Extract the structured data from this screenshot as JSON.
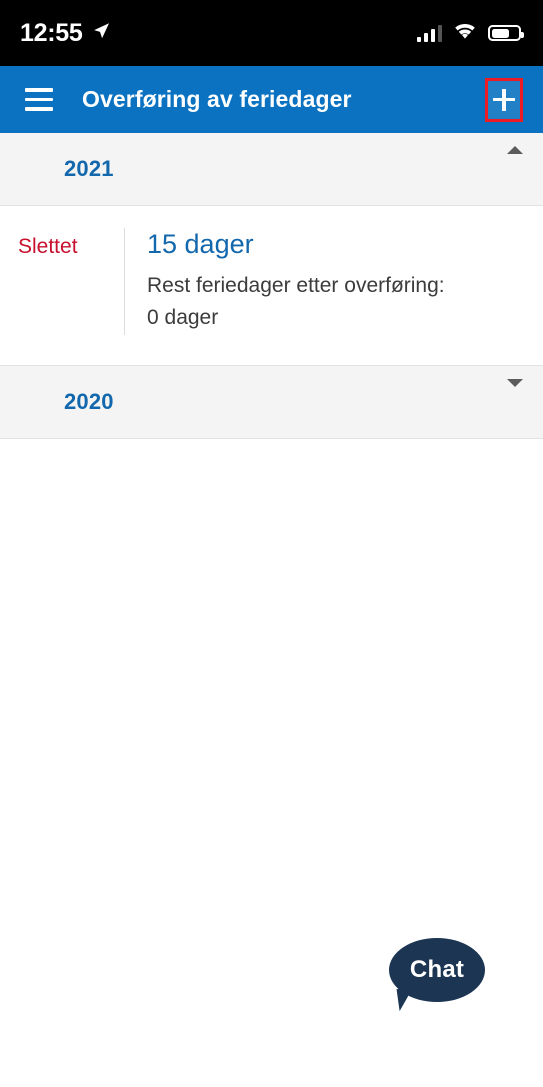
{
  "status_bar": {
    "time": "12:55",
    "location_icon": "location-arrow-icon",
    "signal_icon": "cellular-signal-icon",
    "signal_bars_filled": 3,
    "signal_bars_total": 4,
    "wifi_icon": "wifi-icon",
    "battery_icon": "battery-icon",
    "battery_level_percent": 60
  },
  "app_bar": {
    "menu_icon": "hamburger-menu-icon",
    "title": "Overføring av feriedager",
    "add_icon": "plus-icon",
    "add_label": "+",
    "highlight_color": "#ee1b25",
    "background_color": "#0a72c0"
  },
  "sections": [
    {
      "year": "2021",
      "expanded": true,
      "caret_icon": "chevron-up-icon",
      "rows": [
        {
          "status": "Slettet",
          "status_color": "#c8102e",
          "days": "15 dager",
          "days_color": "#1368ad",
          "detail_label": "Rest feriedager etter overføring:",
          "detail_value": "0 dager"
        }
      ]
    },
    {
      "year": "2020",
      "expanded": false,
      "caret_icon": "chevron-down-icon",
      "rows": []
    }
  ],
  "chat_widget": {
    "label": "Chat",
    "background_color": "#1b3553",
    "icon": "chat-bubble-icon"
  }
}
